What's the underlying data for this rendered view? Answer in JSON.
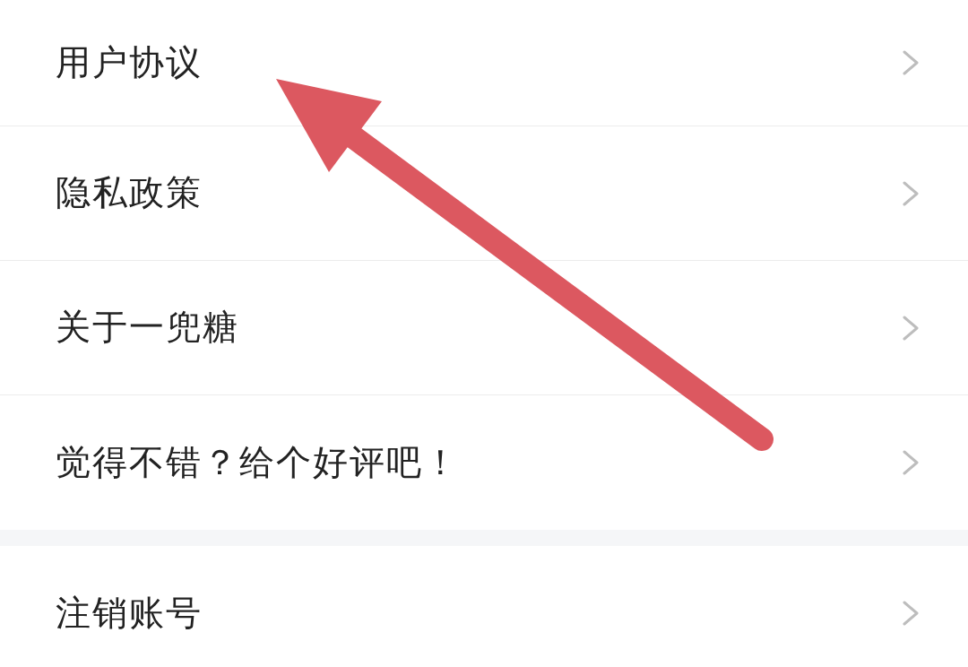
{
  "settings_groups": [
    {
      "items": [
        {
          "label": "用户协议"
        },
        {
          "label": "隐私政策"
        },
        {
          "label": "关于一兜糖"
        },
        {
          "label": "觉得不错？给个好评吧！"
        }
      ]
    },
    {
      "items": [
        {
          "label": "注销账号"
        }
      ]
    }
  ],
  "annotations": [
    {
      "kind": "arrow"
    }
  ]
}
